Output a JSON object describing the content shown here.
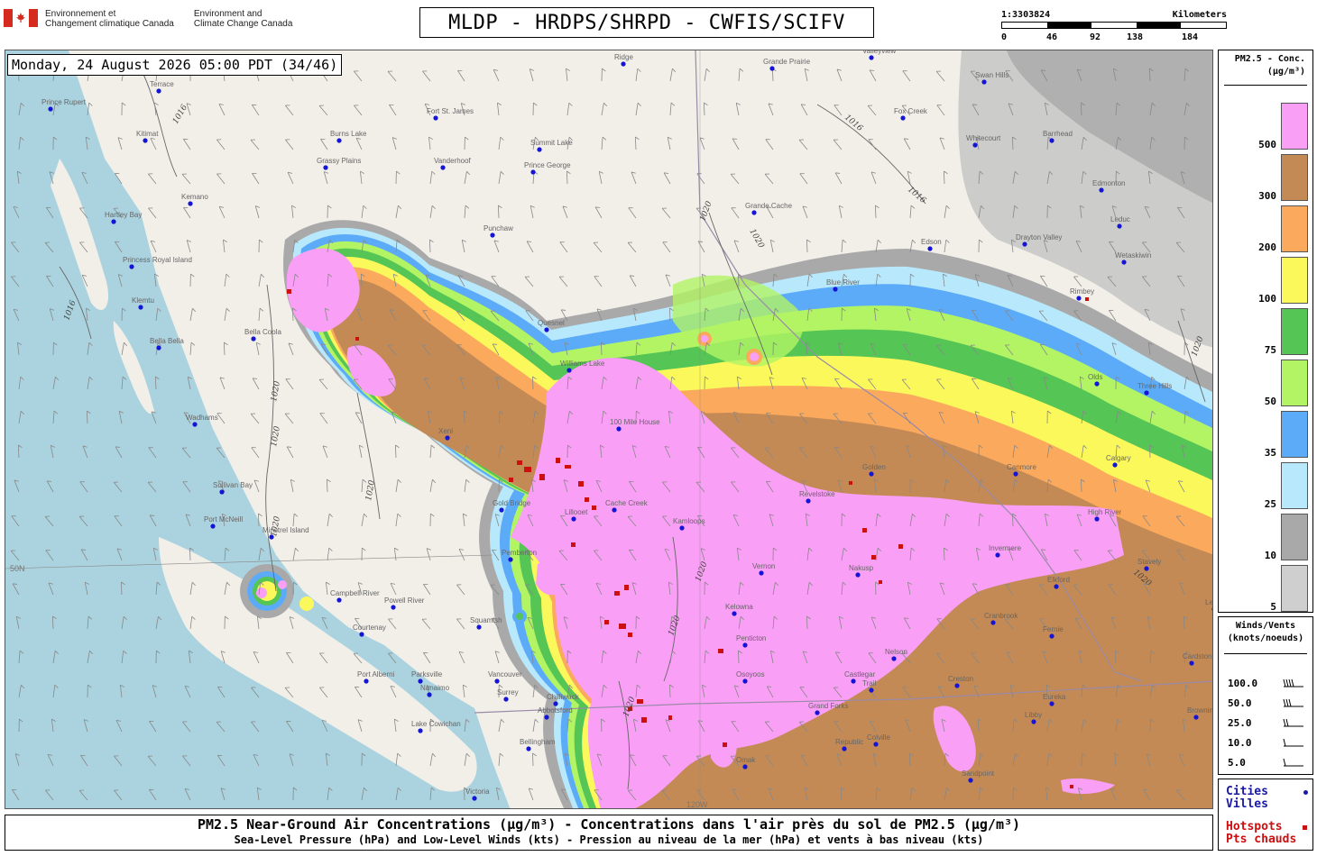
{
  "header": {
    "gov_fr": [
      "Environnement et",
      "Changement climatique Canada"
    ],
    "gov_en": [
      "Environment and",
      "Climate Change Canada"
    ],
    "title": "MLDP - HRDPS/SHRPD - CWFIS/SCIFV",
    "scale": {
      "ratio": "1:3303824",
      "unit": "Kilometers",
      "ticks": [
        "0",
        "46",
        "92",
        "138",
        "184"
      ]
    }
  },
  "map": {
    "datetime": "Monday, 24 August 2026 05:00 PDT (34/46)",
    "latitude_label": "50N",
    "longitude_label": "120W",
    "isobar_labels": [
      "1016",
      "1020"
    ],
    "cities": [
      "Prince Rupert",
      "Terrace",
      "Kitimat",
      "Kemano",
      "Hartley Bay",
      "Princess Royal Island",
      "Klemtu",
      "Bella Bella",
      "Bella Coola",
      "Wadhams",
      "Sullivan Bay",
      "Port McNeill",
      "Minstrel Island",
      "Campbell River",
      "Powell River",
      "Courtenay",
      "Port Alberni",
      "Parksville",
      "Nanaimo",
      "Lake Cowichan",
      "Victoria",
      "Vancouver",
      "Surrey",
      "Abbotsford",
      "Bellingham",
      "Chilliwack",
      "Squamish",
      "Pemberton",
      "Gold Bridge",
      "Lillooet",
      "Cache Creek",
      "Kamloops",
      "100 Mile House",
      "Williams Lake",
      "Quesnel",
      "Prince George",
      "Vanderhoof",
      "Burns Lake",
      "Grassy Plains",
      "Fort St. James",
      "Summit Lake",
      "Punchaw",
      "Grande Cache",
      "Grande Prairie",
      "Valleyview",
      "Swan Hills",
      "Fox Creek",
      "Whitecourt",
      "Barrhead",
      "Edson",
      "Edmonton",
      "Leduc",
      "Drayton Valley",
      "Wetaskiwin",
      "Rimbey",
      "Olds",
      "Three Hills",
      "Calgary",
      "Canmore",
      "High River",
      "Golden",
      "Revelstoke",
      "Invermere",
      "Nakusp",
      "Vernon",
      "Kelowna",
      "Penticton",
      "Osoyoos",
      "Grand Forks",
      "Castlegar",
      "Trail",
      "Nelson",
      "Cranbrook",
      "Fernie",
      "Elkford",
      "Creston",
      "Eureka",
      "Libby",
      "Sandpoint",
      "Omak",
      "Republic",
      "Colville",
      "Stavely",
      "Lethbridge",
      "Cardston",
      "Browning",
      "Blue River",
      "Xeni",
      "Ridge"
    ]
  },
  "legend": {
    "title_line1": "PM2.5 - Conc.",
    "title_line2": "(µg/m³)",
    "bins": [
      {
        "label": "500",
        "color": "#f99ff5"
      },
      {
        "label": "300",
        "color": "#c38a55"
      },
      {
        "label": "200",
        "color": "#fba95c"
      },
      {
        "label": "100",
        "color": "#fbf85c"
      },
      {
        "label": "75",
        "color": "#55c555"
      },
      {
        "label": "50",
        "color": "#b2f464"
      },
      {
        "label": "35",
        "color": "#5cabf9"
      },
      {
        "label": "25",
        "color": "#b8e8fb"
      },
      {
        "label": "10",
        "color": "#a9a9a9"
      },
      {
        "label": "5",
        "color": "#cfcfcf"
      }
    ]
  },
  "winds": {
    "title_line1": "Winds/Vents",
    "title_line2": "(knots/noeuds)",
    "rows": [
      "100.0",
      "50.0",
      "25.0",
      "10.0",
      "5.0"
    ]
  },
  "keys": {
    "cities_en": "Cities",
    "cities_fr": "Villes",
    "hotspots_en": "Hotspots",
    "hotspots_fr": "Pts chauds"
  },
  "footer": {
    "line1": "PM2.5 Near-Ground Air Concentrations (µg/m³) - Concentrations dans l'air près du sol de PM2.5 (µg/m³)",
    "line2": "Sea-Level Pressure (hPa) and Low-Level Winds (kts) - Pression au niveau de la mer (hPa) et vents à bas niveau (kts)"
  }
}
